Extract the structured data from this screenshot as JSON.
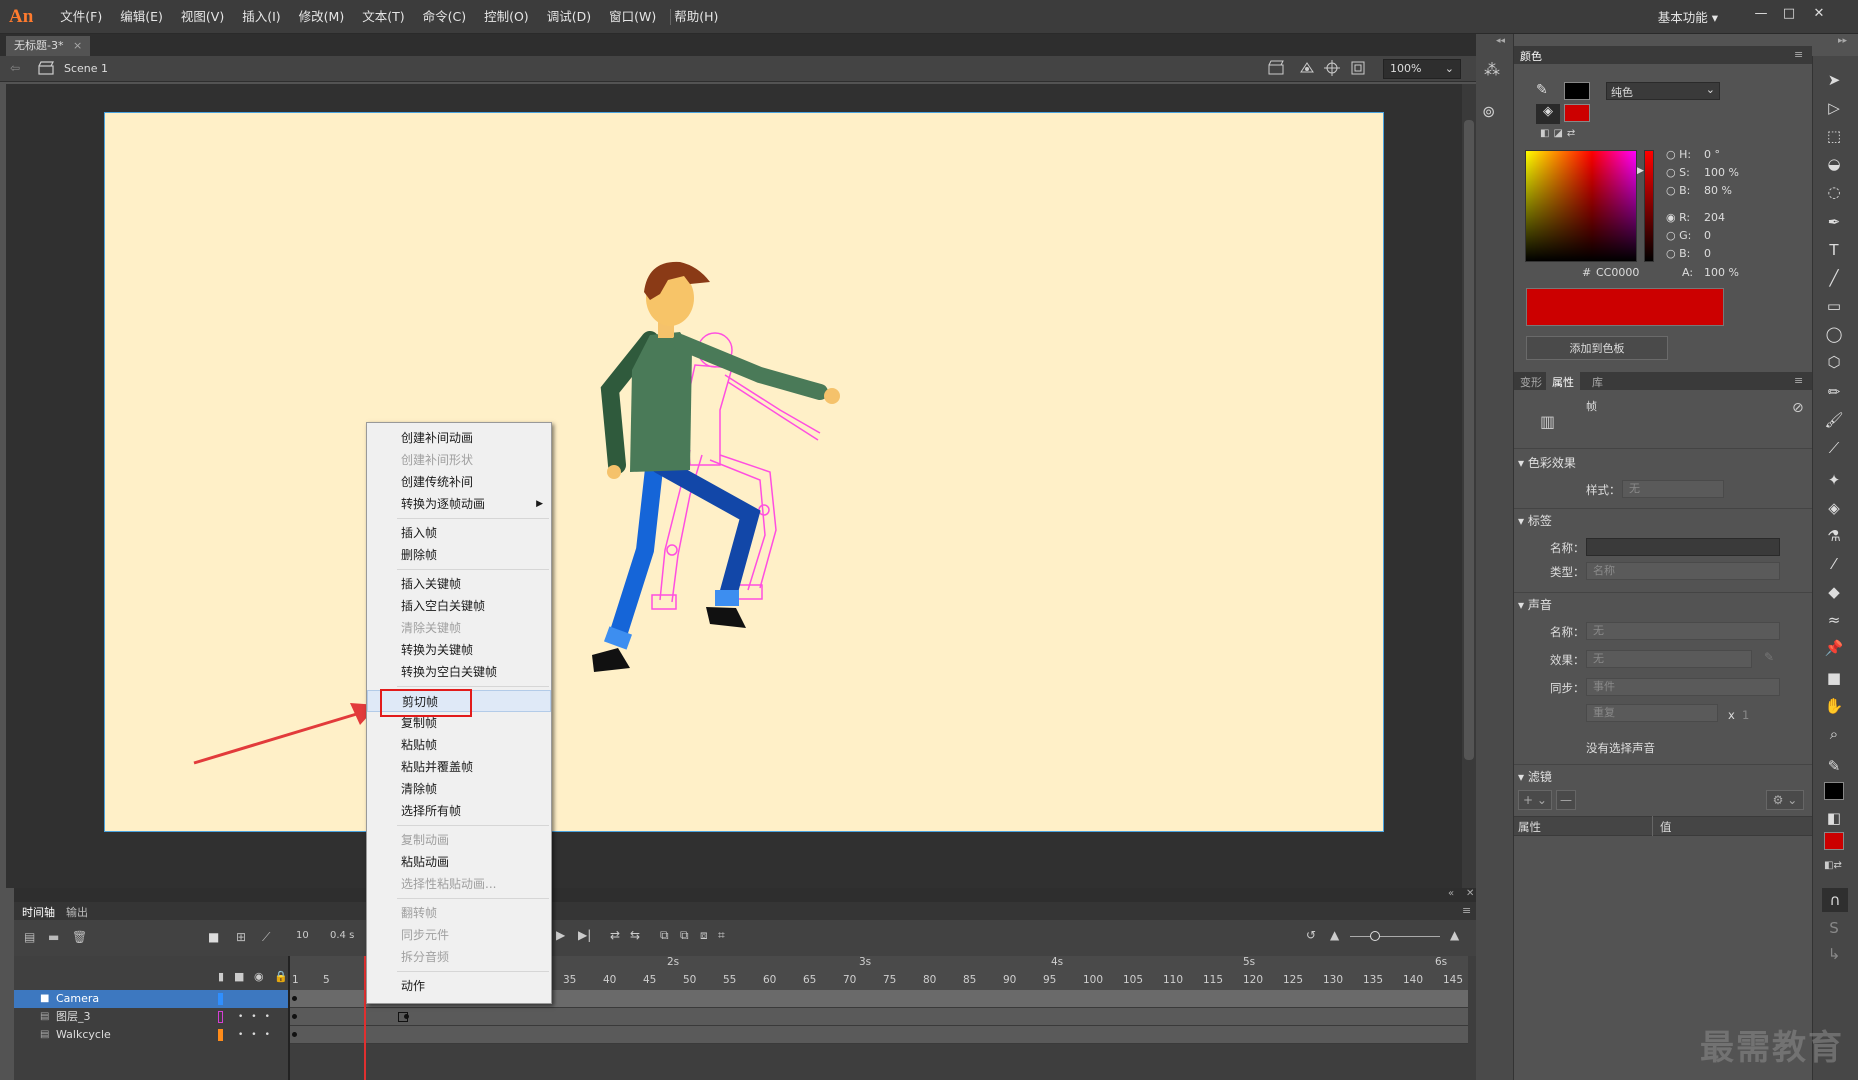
{
  "app": {
    "logo": "An",
    "menus": [
      "文件(F)",
      "编辑(E)",
      "视图(V)",
      "插入(I)",
      "修改(M)",
      "文本(T)",
      "命令(C)",
      "控制(O)",
      "调试(D)",
      "窗口(W)",
      "帮助(H)"
    ],
    "workspace": "基本功能"
  },
  "document": {
    "tab": "无标题-3*",
    "tab_close": "×",
    "scene": "Scene 1",
    "zoom": "100%"
  },
  "context_menu": {
    "items": [
      {
        "label": "创建补间动画",
        "enabled": true
      },
      {
        "label": "创建补间形状",
        "enabled": false
      },
      {
        "label": "创建传统补间",
        "enabled": true
      },
      {
        "label": "转换为逐帧动画",
        "enabled": true,
        "submenu": true
      },
      {
        "label": "插入帧",
        "enabled": true,
        "sep_before": true
      },
      {
        "label": "删除帧",
        "enabled": true
      },
      {
        "label": "插入关键帧",
        "enabled": true,
        "sep_before": true
      },
      {
        "label": "插入空白关键帧",
        "enabled": true
      },
      {
        "label": "清除关键帧",
        "enabled": false
      },
      {
        "label": "转换为关键帧",
        "enabled": true
      },
      {
        "label": "转换为空白关键帧",
        "enabled": true
      },
      {
        "label": "剪切帧",
        "enabled": true,
        "sep_before": true,
        "highlighted": true
      },
      {
        "label": "复制帧",
        "enabled": true
      },
      {
        "label": "粘贴帧",
        "enabled": true
      },
      {
        "label": "粘贴并覆盖帧",
        "enabled": true
      },
      {
        "label": "清除帧",
        "enabled": true
      },
      {
        "label": "选择所有帧",
        "enabled": true
      },
      {
        "label": "复制动画",
        "enabled": false,
        "sep_before": true
      },
      {
        "label": "粘贴动画",
        "enabled": true
      },
      {
        "label": "选择性粘贴动画...",
        "enabled": false
      },
      {
        "label": "翻转帧",
        "enabled": false,
        "sep_before": true
      },
      {
        "label": "同步元件",
        "enabled": false
      },
      {
        "label": "拆分音频",
        "enabled": false
      },
      {
        "label": "动作",
        "enabled": true,
        "sep_before": true
      }
    ]
  },
  "timeline": {
    "tabs": [
      "时间轴",
      "输出"
    ],
    "fps_value": "10",
    "time_value": "0.4 s",
    "ruler_frames": [
      "1",
      "5",
      "35",
      "40",
      "45",
      "50",
      "55",
      "60",
      "65",
      "70",
      "75",
      "80",
      "85",
      "90",
      "95",
      "100",
      "105",
      "110",
      "115",
      "120",
      "125",
      "130",
      "135",
      "140",
      "145"
    ],
    "ruler_seconds": [
      "2s",
      "3s",
      "4s",
      "5s",
      "6s"
    ],
    "layers": [
      {
        "name": "Camera",
        "color": "#2f8fff",
        "selected": true
      },
      {
        "name": "图层_3",
        "color": "#d43fd4",
        "selected": false
      },
      {
        "name": "Walkcycle",
        "color": "#ff8c1a",
        "selected": false
      }
    ]
  },
  "color_panel": {
    "title": "颜色",
    "fill_type": "纯色",
    "hsb": {
      "h_label": "H:",
      "h": "0 °",
      "s_label": "S:",
      "s": "100 %",
      "b_label": "B:",
      "b": "80 %"
    },
    "rgb": {
      "r_label": "R:",
      "r": "204",
      "g_label": "G:",
      "g": "0",
      "b_label": "B:",
      "b": "0"
    },
    "hex_label": "#",
    "hex": "CC0000",
    "alpha_label": "A:",
    "alpha": "100 %",
    "swatch_color": "#cc0000",
    "add_button": "添加到色板"
  },
  "properties_panel": {
    "tabs": [
      "变形",
      "属性",
      "库"
    ],
    "frame_label": "帧",
    "sections": {
      "color_effect": "色彩效果",
      "style_label": "样式：",
      "style_value": "无",
      "label": "标签",
      "name_label": "名称：",
      "type_label": "类型：",
      "type_value": "名称",
      "sound": "声音",
      "sound_name_label": "名称：",
      "sound_name_value": "无",
      "effect_label": "效果：",
      "effect_value": "无",
      "sync_label": "同步：",
      "sync_value": "事件",
      "repeat_value": "重复",
      "repeat_x": "x",
      "repeat_count": "1",
      "no_sound": "没有选择声音",
      "filter": "滤镜",
      "col_prop": "属性",
      "col_value": "值"
    }
  },
  "watermark": "最需教育"
}
